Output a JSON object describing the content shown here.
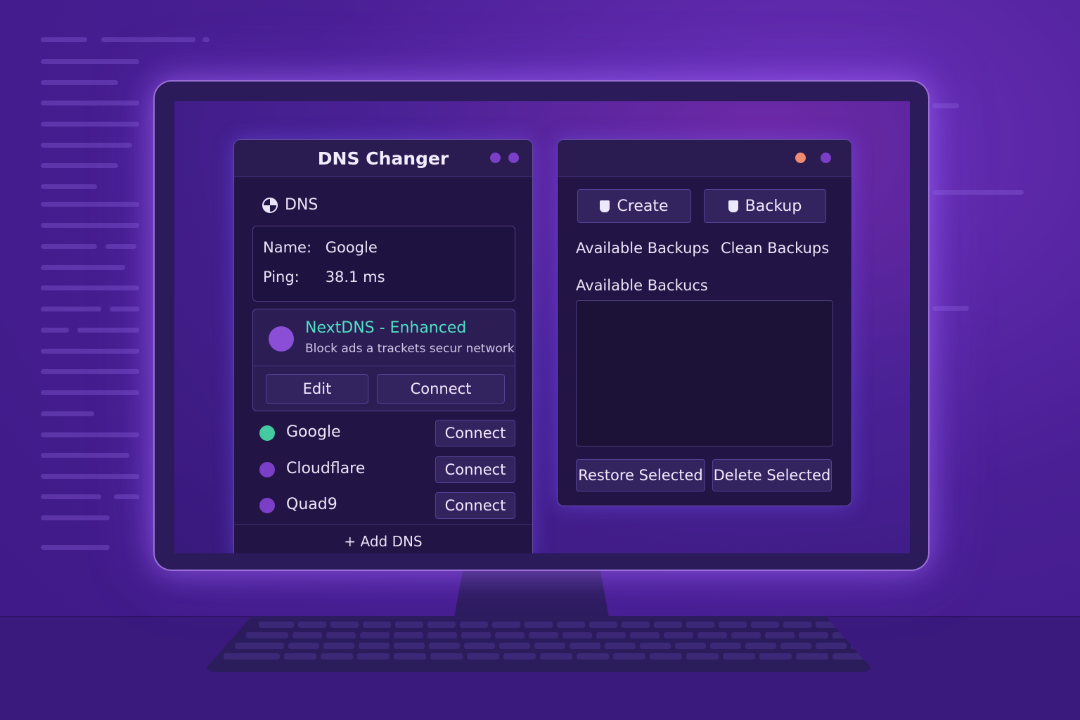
{
  "colors": {
    "background": "#4a1f95",
    "window": "#221545",
    "accent_teal": "#4fe0c4",
    "status_active": "#45c9a0",
    "status_inactive": "#7b3fc7"
  },
  "left_window": {
    "title": "DNS Changer",
    "section_label": "DNS",
    "section_icon": "globe-icon",
    "current": {
      "name_key": "Name:",
      "name_value": "Google",
      "ping_key": "Ping:",
      "ping_value": "38.1 ms"
    },
    "featured": {
      "name": "NextDNS - Enhanced",
      "description": "Block ads a trackets secur network",
      "edit_label": "Edit",
      "connect_label": "Connect"
    },
    "servers": [
      {
        "name": "Google",
        "action": "Connect",
        "status": "active"
      },
      {
        "name": "Cloudflare",
        "action": "Connect",
        "status": "inactive"
      },
      {
        "name": "Quad9",
        "action": "Connect",
        "status": "inactive"
      }
    ],
    "add_label": "+ Add DNS"
  },
  "right_window": {
    "create_label": "Create",
    "backup_label": "Backup",
    "available_backups_label": "Available Backups",
    "clean_backups_label": "Clean Backups",
    "list_heading": "Available Backucs",
    "restore_label": "Restore Selected",
    "delete_label": "Delete Selected"
  }
}
